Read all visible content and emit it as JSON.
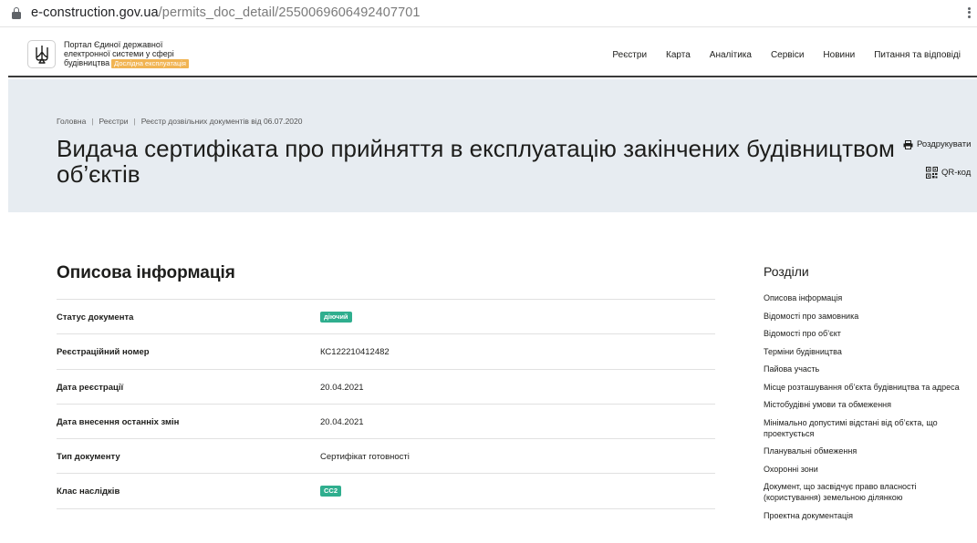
{
  "browser": {
    "url_host": "e-construction.gov.ua",
    "url_path": "/permits_doc_detail/2550069606492407701"
  },
  "header": {
    "portal_lines": [
      "Портал Єдиної державної",
      "електронної системи у сфері",
      "будівництва"
    ],
    "beta_badge": "Дослідна експлуатація",
    "nav": [
      "Реєстри",
      "Карта",
      "Аналітика",
      "Сервіси",
      "Новини",
      "Питання та відповіді"
    ]
  },
  "hero": {
    "breadcrumbs": [
      "Головна",
      "Реєстри",
      "Реєстр дозвільних документів від 06.07.2020"
    ],
    "title": "Видача сертифіката про прийняття в експлуатацію закінчених будівництвом об’єктів",
    "print_label": "Роздрукувати",
    "qr_label": "QR-код"
  },
  "main": {
    "section_title": "Описова інформація",
    "rows": [
      {
        "label": "Статус документа",
        "value": "діючий",
        "chip": true
      },
      {
        "label": "Реєстраційний номер",
        "value": "КС122210412482",
        "chip": false
      },
      {
        "label": "Дата реєстрації",
        "value": "20.04.2021",
        "chip": false
      },
      {
        "label": "Дата внесення останніх змін",
        "value": "20.04.2021",
        "chip": false
      },
      {
        "label": "Тип документу",
        "value": "Сертифікат готовності",
        "chip": false
      },
      {
        "label": "Клас наслідків",
        "value": "СС2",
        "chip": true
      }
    ]
  },
  "sidebar": {
    "title": "Розділи",
    "items": [
      {
        "text": "Описова інформація",
        "gap": 7.5
      },
      {
        "text": "Відомості про замовника",
        "gap": 7.5
      },
      {
        "text": "Відомості про об’єкт",
        "gap": 7.5
      },
      {
        "text": "Терміни будівництва",
        "gap": 7.5
      },
      {
        "text": "Пайова участь",
        "gap": 7.5
      },
      {
        "text": "Місце розташування об’єкта будівництва та адреса",
        "gap": 7.5
      },
      {
        "text": "Містобудівні умови та обмеження",
        "gap": 7.5
      },
      {
        "text": "Мінімально допустимі відстані від об’єкта, що проектується",
        "gap": 7.5
      },
      {
        "text": "Планувальні обмеження",
        "gap": 7.5
      },
      {
        "text": "Охоронні зони",
        "gap": 7.5
      },
      {
        "text": "Документ, що засвідчує право власності (користування) земельною ділянкою",
        "gap": 7.5
      },
      {
        "text": "Проектна документація",
        "gap": 7.5
      }
    ]
  },
  "colors": {
    "hero_bg": "#e7ecf1",
    "chip_green": "#2fae8e",
    "beta_orange": "#f1b452"
  }
}
